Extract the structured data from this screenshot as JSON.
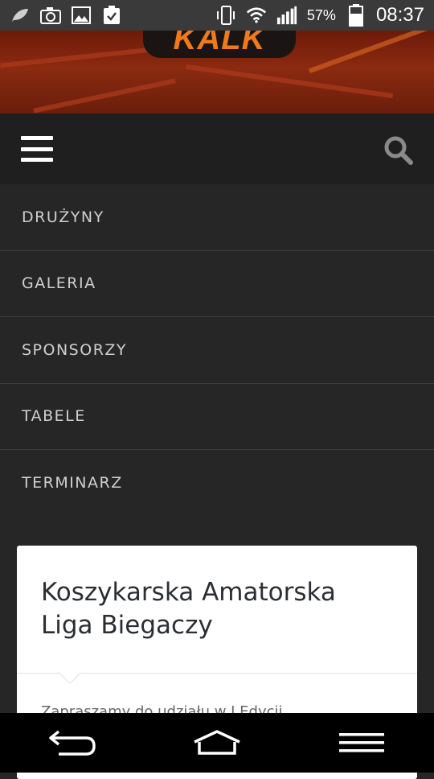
{
  "status_bar": {
    "icons_left": [
      "leaf-icon",
      "camera-icon",
      "image-icon",
      "clipboard-check-icon"
    ],
    "icons_right": [
      "vibrate-icon",
      "wifi-icon",
      "signal-icon",
      "battery-icon"
    ],
    "battery": "57%",
    "time": "08:37"
  },
  "banner": {
    "logo_text": "KALK",
    "colors": {
      "background": "#8b2a10",
      "logo": "#f07a1a"
    }
  },
  "topbar": {
    "menu_icon": "hamburger-icon",
    "search_icon": "search-icon"
  },
  "menu": {
    "items": [
      {
        "label": "DRUŻYNY"
      },
      {
        "label": "GALERIA"
      },
      {
        "label": "SPONSORZY"
      },
      {
        "label": "TABELE"
      },
      {
        "label": "TERMINARZ"
      }
    ]
  },
  "card": {
    "title": "Koszykarska Amatorska Liga Biegaczy",
    "text_partial": "Zapraszamy do udziału w I Edycji"
  },
  "nav_bar": {
    "icons": [
      "back-icon",
      "home-icon",
      "menu-icon"
    ]
  }
}
